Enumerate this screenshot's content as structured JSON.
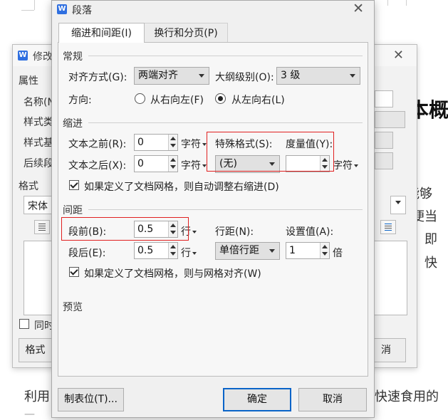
{
  "background_document": {
    "heading_fragment": "本概",
    "text_fragments": [
      "能够",
      "便当",
      "，即",
      "。快"
    ],
    "bottom_left_text": "利用",
    "bottom_right_text": "快速食用的"
  },
  "background_dialog": {
    "title": "修改",
    "properties_label": "属性",
    "name_label": "名称(N",
    "style_type_label": "样式类",
    "style_based_label": "样式基",
    "next_style_label": "后续段",
    "format_label": "格式",
    "font_value": "宋体",
    "sync_label": "同时",
    "format_button": "格式",
    "cancel_button": "消"
  },
  "dialog": {
    "title": "段落",
    "close_glyph": "✕",
    "tabs": [
      {
        "label": "缩进和间距(I)",
        "active": true
      },
      {
        "label": "换行和分页(P)",
        "active": false
      }
    ],
    "general": {
      "section_title": "常规",
      "alignment_label": "对齐方式(G):",
      "alignment_value": "两端对齐",
      "outline_label": "大纲级别(O):",
      "outline_value": "3 级",
      "direction_label": "方向:",
      "direction_rtl": "从右向左(F)",
      "direction_ltr": "从左向右(L)"
    },
    "indent": {
      "section_title": "缩进",
      "before_label": "文本之前(R):",
      "before_value": "0",
      "before_unit": "字符",
      "after_label": "文本之后(X):",
      "after_value": "0",
      "after_unit": "字符",
      "special_label": "特殊格式(S):",
      "special_value": "(无)",
      "measure_label": "度量值(Y):",
      "measure_value": "",
      "measure_unit": "字符",
      "auto_adjust_label": "如果定义了文档网格，则自动调整右缩进(D)"
    },
    "spacing": {
      "section_title": "间距",
      "before_label": "段前(B):",
      "before_value": "0.5",
      "before_unit": "行",
      "after_label": "段后(E):",
      "after_value": "0.5",
      "after_unit": "行",
      "line_spacing_label": "行距(N):",
      "line_spacing_value": "单倍行距",
      "set_value_label": "设置值(A):",
      "set_value": "1",
      "set_value_unit": "倍",
      "snap_grid_label": "如果定义了文档网格，则与网格对齐(W)"
    },
    "preview": {
      "section_title": "预览"
    },
    "buttons": {
      "tabs_button": "制表位(T)...",
      "ok": "确定",
      "cancel": "取消"
    }
  },
  "colors": {
    "annotation_red": "#e02020",
    "default_button_border": "#0a64c8",
    "wps_icon_blue": "#2f6fe0"
  }
}
